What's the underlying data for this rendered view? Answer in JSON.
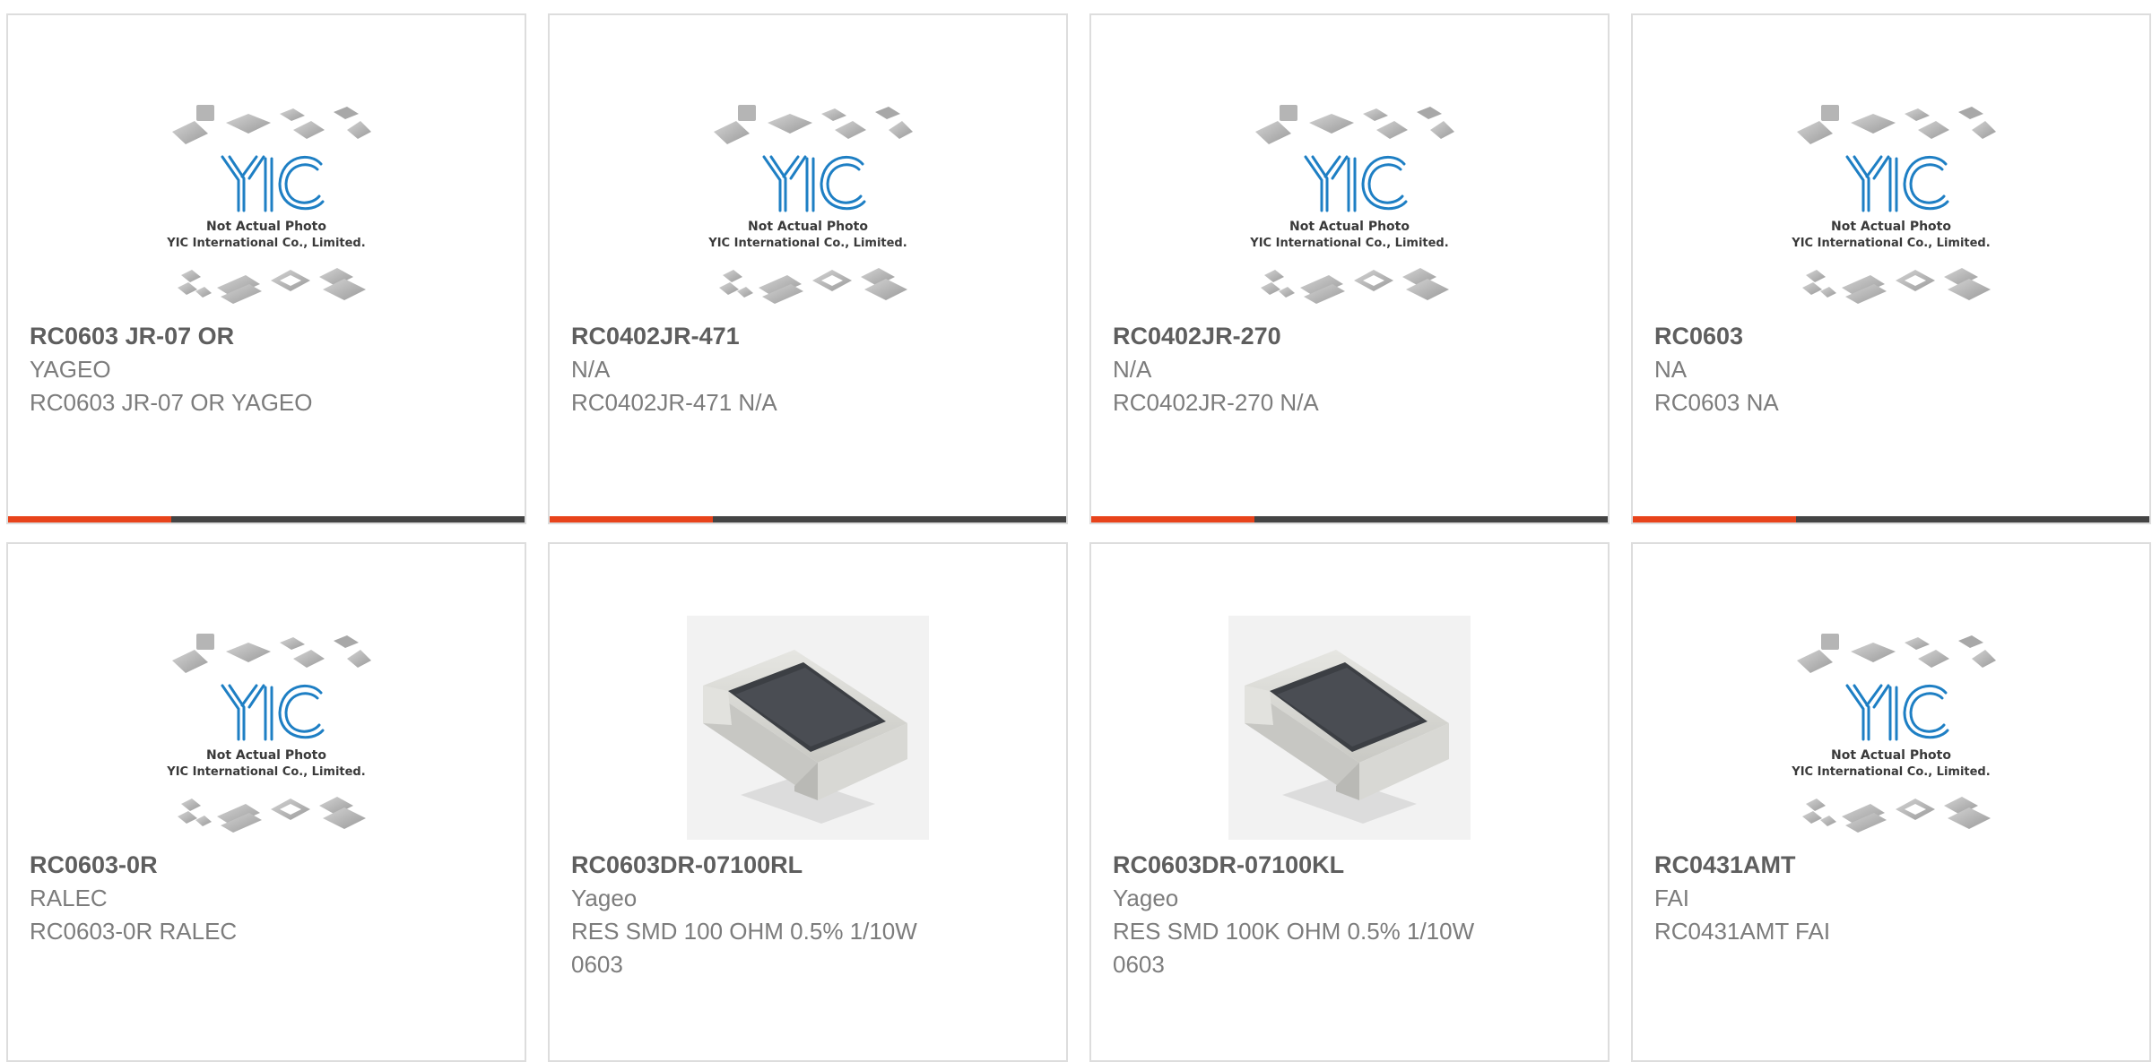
{
  "placeholder_image": {
    "logo_text": "YIC",
    "line1": "Not Actual Photo",
    "line2": "YIC International Co., Limited."
  },
  "colors": {
    "accent_bar": "#e8431b",
    "dark_bar": "#444444",
    "logo_blue": "#1e7fc4"
  },
  "products": [
    {
      "part": "RC0603 JR-07 OR",
      "maker": "YAGEO",
      "desc": "RC0603 JR-07 OR YAGEO",
      "image": "yic-placeholder"
    },
    {
      "part": "RC0402JR-471",
      "maker": "N/A",
      "desc": "RC0402JR-471 N/A",
      "image": "yic-placeholder"
    },
    {
      "part": "RC0402JR-270",
      "maker": "N/A",
      "desc": "RC0402JR-270 N/A",
      "image": "yic-placeholder"
    },
    {
      "part": "RC0603",
      "maker": "NA",
      "desc": "RC0603 NA",
      "image": "yic-placeholder"
    },
    {
      "part": "RC0603-0R",
      "maker": "RALEC",
      "desc": "RC0603-0R RALEC",
      "image": "yic-placeholder"
    },
    {
      "part": "RC0603DR-07100RL",
      "maker": "Yageo",
      "desc": "RES SMD 100 OHM 0.5% 1/10W 0603",
      "image": "smd-resistor-photo"
    },
    {
      "part": "RC0603DR-07100KL",
      "maker": "Yageo",
      "desc": "RES SMD 100K OHM 0.5% 1/10W 0603",
      "image": "smd-resistor-photo"
    },
    {
      "part": "RC0431AMT",
      "maker": "FAI",
      "desc": "RC0431AMT FAI",
      "image": "yic-placeholder"
    }
  ]
}
